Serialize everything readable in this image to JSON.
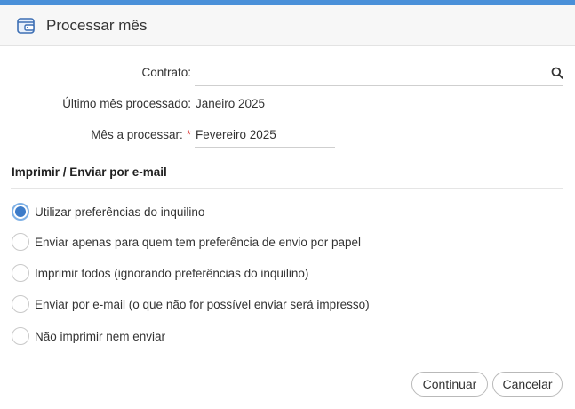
{
  "dialog": {
    "title": "Processar mês",
    "icon": "wallet-icon",
    "accent_color": "#4a90d9"
  },
  "form": {
    "contrato": {
      "label": "Contrato:",
      "value": "",
      "icon": "search-icon"
    },
    "ultimo_mes": {
      "label": "Último mês processado:",
      "value": "Janeiro 2025"
    },
    "mes_processar": {
      "label": "Mês a processar:",
      "required_marker": "*",
      "value": "Fevereiro 2025"
    }
  },
  "section": {
    "title": "Imprimir / Enviar por e-mail"
  },
  "options": [
    {
      "label": "Utilizar preferências do inquilino",
      "checked": true
    },
    {
      "label": "Enviar apenas para quem tem preferência de envio por papel",
      "checked": false
    },
    {
      "label": "Imprimir todos (ignorando preferências do inquilino)",
      "checked": false
    },
    {
      "label": "Enviar por e-mail (o que não for possível enviar será impresso)",
      "checked": false
    },
    {
      "label": "Não imprimir nem enviar",
      "checked": false
    }
  ],
  "buttons": {
    "continue": "Continuar",
    "cancel": "Cancelar"
  }
}
